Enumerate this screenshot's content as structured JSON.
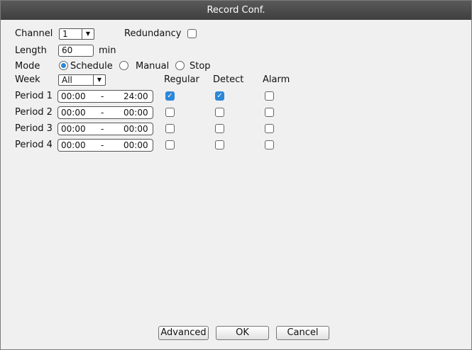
{
  "window": {
    "title": "Record Conf."
  },
  "channel": {
    "label": "Channel",
    "value": "1"
  },
  "redundancy": {
    "label": "Redundancy",
    "checked": false
  },
  "length": {
    "label": "Length",
    "value": "60",
    "unit": "min"
  },
  "mode": {
    "label": "Mode",
    "options": [
      {
        "label": "Schedule",
        "selected": true
      },
      {
        "label": "Manual",
        "selected": false
      },
      {
        "label": "Stop",
        "selected": false
      }
    ]
  },
  "week": {
    "label": "Week",
    "value": "All"
  },
  "columns": {
    "regular": "Regular",
    "detect": "Detect",
    "alarm": "Alarm"
  },
  "periods": [
    {
      "label": "Period 1",
      "start": "00:00",
      "sep": "-",
      "end": "24:00",
      "regular": true,
      "detect": true,
      "alarm": false
    },
    {
      "label": "Period 2",
      "start": "00:00",
      "sep": "-",
      "end": "00:00",
      "regular": false,
      "detect": false,
      "alarm": false
    },
    {
      "label": "Period 3",
      "start": "00:00",
      "sep": "-",
      "end": "00:00",
      "regular": false,
      "detect": false,
      "alarm": false
    },
    {
      "label": "Period 4",
      "start": "00:00",
      "sep": "-",
      "end": "00:00",
      "regular": false,
      "detect": false,
      "alarm": false
    }
  ],
  "buttons": {
    "advanced": "Advanced",
    "ok": "OK",
    "cancel": "Cancel"
  },
  "colors": {
    "accent": "#2b87d8",
    "titlebar": "#4a4a4a",
    "background": "#f0f0f0"
  }
}
